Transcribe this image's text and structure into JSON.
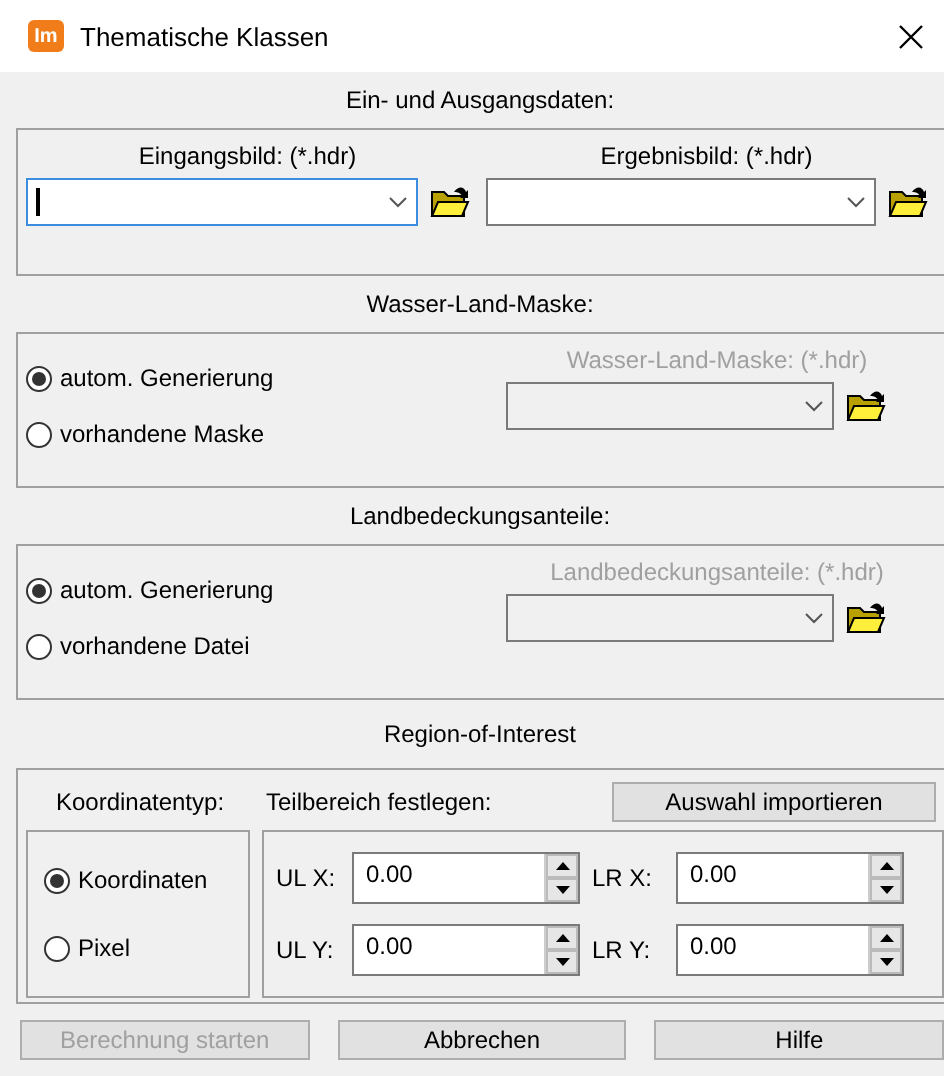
{
  "window": {
    "title": "Thematische Klassen",
    "app_icon_text": "Im"
  },
  "sections": [
    {
      "kind": "files",
      "title": "Ein- und Ausgangsdaten:",
      "fields": [
        {
          "label": "Eingangsbild: (*.hdr)",
          "focused": true
        },
        {
          "label": "Ergebnisbild: (*.hdr)",
          "focused": false
        }
      ]
    },
    {
      "kind": "source",
      "title": "Wasser-Land-Maske:",
      "options": [
        {
          "label": "autom. Generierung",
          "selected": true
        },
        {
          "label": "vorhandene Maske",
          "selected": false
        }
      ],
      "file": {
        "label": "Wasser-Land-Maske: (*.hdr)",
        "disabled": true
      }
    },
    {
      "kind": "source",
      "title": "Landbedeckungsanteile:",
      "options": [
        {
          "label": "autom. Generierung",
          "selected": true
        },
        {
          "label": "vorhandene Datei",
          "selected": false
        }
      ],
      "file": {
        "label": "Landbedeckungsanteile: (*.hdr)",
        "disabled": true
      }
    }
  ],
  "roi": {
    "title": "Region-of-Interest",
    "type_label": "Koordinatentyp:",
    "area_label": "Teilbereich festlegen:",
    "import_button": "Auswahl importieren",
    "options": [
      {
        "label": "Koordinaten",
        "selected": true
      },
      {
        "label": "Pixel",
        "selected": false
      }
    ],
    "fields": [
      {
        "label": "UL X:",
        "value": "0.00"
      },
      {
        "label": "LR X:",
        "value": "0.00"
      },
      {
        "label": "UL Y:",
        "value": "0.00"
      },
      {
        "label": "LR Y:",
        "value": "0.00"
      }
    ]
  },
  "buttons": [
    {
      "label": "Berechnung starten",
      "disabled": true
    },
    {
      "label": "Abbrechen",
      "disabled": false
    },
    {
      "label": "Hilfe",
      "disabled": false
    }
  ]
}
